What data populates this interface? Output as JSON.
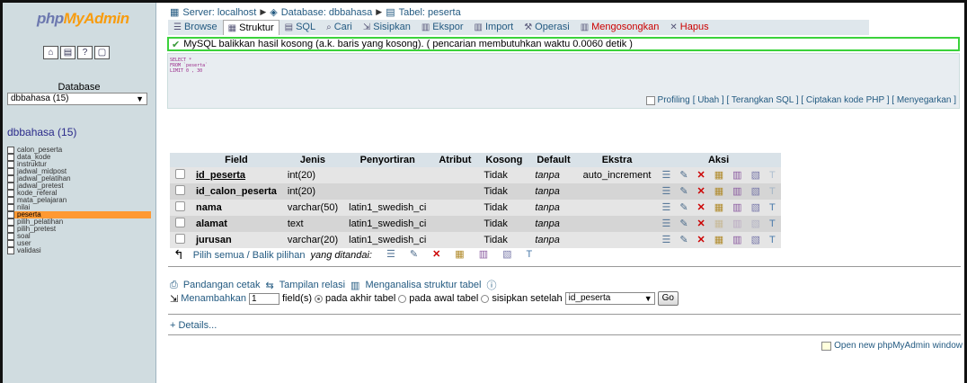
{
  "nav": {
    "logo_part1": "php",
    "logo_part2": "MyAdmin",
    "database_label": "Database",
    "database_selected": "dbbahasa (15)",
    "database_title": "dbbahasa (15)",
    "tables": [
      "calon_peserta",
      "data_kode",
      "instruktur",
      "jadwal_midpost",
      "jadwal_pelatihan",
      "jadwal_pretest",
      "kode_referal",
      "mata_pelajaran",
      "nilai",
      "peserta",
      "pilih_pelatihan",
      "pilih_pretest",
      "soal",
      "user",
      "validasi"
    ],
    "active_table": "peserta"
  },
  "breadcrumb": {
    "server": "Server: localhost",
    "database": "Database: dbbahasa",
    "table": "Tabel: peserta"
  },
  "tabs": [
    {
      "label": "Browse",
      "icon": "browse-icon"
    },
    {
      "label": "Struktur",
      "icon": "structure-icon",
      "active": true
    },
    {
      "label": "SQL",
      "icon": "sql-icon"
    },
    {
      "label": "Cari",
      "icon": "search-icon"
    },
    {
      "label": "Sisipkan",
      "icon": "insert-icon"
    },
    {
      "label": "Ekspor",
      "icon": "export-icon"
    },
    {
      "label": "Import",
      "icon": "import-icon"
    },
    {
      "label": "Operasi",
      "icon": "operations-icon"
    },
    {
      "label": "Mengosongkan",
      "icon": "empty-icon"
    },
    {
      "label": "Hapus",
      "icon": "drop-icon"
    }
  ],
  "success_message": "MySQL balikkan hasil kosong (a.k. baris yang kosong). ( pencarian membutuhkan waktu 0.0060 detik )",
  "sql": {
    "line1": "SELECT *",
    "line2": "FROM `peserta`",
    "line3": "LIMIT 0 , 30"
  },
  "sql_links": {
    "profiling": "Profiling",
    "links": "[ Ubah ] [ Terangkan SQL ] [ Ciptakan kode PHP ] [ Menyegarkan ]"
  },
  "structure": {
    "headers": [
      "Field",
      "Jenis",
      "Penyortiran",
      "Atribut",
      "Kosong",
      "Default",
      "Ekstra",
      "Aksi"
    ],
    "rows": [
      {
        "field": "id_peserta",
        "type": "int(20)",
        "collation": "",
        "attribute": "",
        "null": "Tidak",
        "default": "tanpa",
        "extra": "auto_increment"
      },
      {
        "field": "id_calon_peserta",
        "type": "int(20)",
        "collation": "",
        "attribute": "",
        "null": "Tidak",
        "default": "tanpa",
        "extra": ""
      },
      {
        "field": "nama",
        "type": "varchar(50)",
        "collation": "latin1_swedish_ci",
        "attribute": "",
        "null": "Tidak",
        "default": "tanpa",
        "extra": ""
      },
      {
        "field": "alamat",
        "type": "text",
        "collation": "latin1_swedish_ci",
        "attribute": "",
        "null": "Tidak",
        "default": "tanpa",
        "extra": ""
      },
      {
        "field": "jurusan",
        "type": "varchar(20)",
        "collation": "latin1_swedish_ci",
        "attribute": "",
        "null": "Tidak",
        "default": "tanpa",
        "extra": ""
      }
    ]
  },
  "bulk": {
    "label": "Pilih semua / Balik pilihan",
    "with_selected": "yang ditandai:"
  },
  "footer_links": {
    "print_view": "Pandangan cetak",
    "relation_view": "Tampilan relasi",
    "analyze": "Menganalisa struktur tabel"
  },
  "add_fields": {
    "label": "Menambahkan",
    "count": "1",
    "fields_text": "field(s)",
    "opt_end": "pada akhir tabel",
    "opt_begin": "pada awal tabel",
    "opt_after": "sisipkan setelah",
    "after_field": "id_peserta",
    "go": "Go"
  },
  "details_link": "+ Details...",
  "open_window": "Open new phpMyAdmin window"
}
